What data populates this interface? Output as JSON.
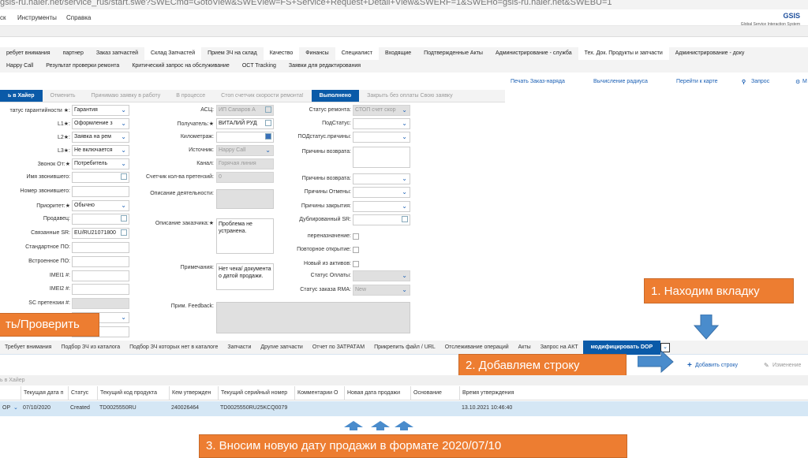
{
  "browser": {
    "url": "gsis-ru.haier.net/service_rus/start.swe?SWECmd=GotoView&SWEView=FS+Service+Request+Detail+View&SWERF=1&SWEHo=gsis-ru.haier.net&SWEBU=1"
  },
  "menu": {
    "items": [
      "ск",
      "Инструменты",
      "Справка"
    ],
    "logo": "GSIS",
    "logo_sub": "Global Service Interaction System"
  },
  "tabs_row1": [
    "ребует внимания",
    "партнер",
    "Заказ запчастей",
    "Склад Запчастей",
    "Прием ЗЧ на склад",
    "Качество",
    "Финансы",
    "Специалист",
    "Входящие",
    "Подтвержденные Акты",
    "Администрирование - служба",
    "Тех. Док. Продукты и запчасти",
    "Администрирование - доку"
  ],
  "tabs_row2": [
    "Happy Call",
    "Результат проверки ремонта",
    "Критический запрос на обслуживание",
    "OCT Tracking",
    "Заявки для редактирования"
  ],
  "actions": [
    "Печать Заказ-наряда",
    "Вычисление радиуса",
    "Перейти к карте",
    "Запрос",
    "М"
  ],
  "status_buttons": [
    "ь в Хайер",
    "Отменить",
    "Принимаю заявку в работу",
    "В процессе",
    "Стоп счетчик скорости ремонта!",
    "Выполнено",
    "Закрыть без оплаты Свою заявку"
  ],
  "form": {
    "left": [
      {
        "label": "татус гарантийности ★:",
        "value": "Гарантия",
        "type": "select"
      },
      {
        "label": "L1★:",
        "value": "Оформление з",
        "type": "select"
      },
      {
        "label": "L2★:",
        "value": "Заявка на рем",
        "type": "select"
      },
      {
        "label": "L3★:",
        "value": "Не включается",
        "type": "select"
      },
      {
        "label": "Звонок От:★",
        "value": "Потребитель",
        "type": "select"
      },
      {
        "label": "Имя звонившего:",
        "value": "",
        "type": "pick"
      },
      {
        "label": "Номер звонившего:",
        "value": "",
        "type": "text"
      },
      {
        "label": "Приоритет:★",
        "value": "Обычно",
        "type": "select"
      },
      {
        "label": "Продавец:",
        "value": "",
        "type": "pick"
      },
      {
        "label": "Связанные SR:",
        "value": "EU/RU21071800",
        "type": "pick"
      },
      {
        "label": "Стандартное ПО:",
        "value": "",
        "type": "text"
      },
      {
        "label": "Встроенное ПО:",
        "value": "",
        "type": "text"
      },
      {
        "label": "IMEI1 #:",
        "value": "",
        "type": "text"
      },
      {
        "label": "IMEI2 #:",
        "value": "",
        "type": "text"
      },
      {
        "label": "SC претензии #:",
        "value": "",
        "type": "ro"
      },
      {
        "label": "",
        "value": "",
        "type": "select"
      },
      {
        "label": "",
        "value": "",
        "type": "text"
      }
    ],
    "middle": [
      {
        "label": "АСЦ:",
        "value": "ИП Сапаров А",
        "type": "ropick"
      },
      {
        "label": "Получатель:★",
        "value": "ВИТАЛИЙ РУД",
        "type": "pick"
      },
      {
        "label": "Километраж:",
        "value": "",
        "type": "calc"
      },
      {
        "label": "Источник:",
        "value": "Happy Call",
        "type": "roselect"
      },
      {
        "label": "Канал:",
        "value": "Горячая линия",
        "type": "ro"
      },
      {
        "label": "Счетчик кол-ва претензий:",
        "value": "0",
        "type": "ro"
      }
    ],
    "middle_areas": [
      {
        "label": "Описание деятельности:",
        "value": "",
        "ro": true
      },
      {
        "label": "Описание заказчика:★",
        "value": "Проблема не устранена.",
        "ro": false
      },
      {
        "label": "Примечания:",
        "value": "Нет чека/ документа о датой продажи.",
        "ro": false
      },
      {
        "label": "Прим. Feedback:",
        "value": "",
        "ro": true
      }
    ],
    "right": [
      {
        "label": "Статус ремонта:",
        "value": "СТОП счет скор",
        "type": "roselect"
      },
      {
        "label": "ПодСтатус:",
        "value": "",
        "type": "select"
      },
      {
        "label": "ПОДстатус.причины:",
        "value": "",
        "type": "select"
      },
      {
        "label": "Причины возврата:",
        "value": "",
        "type": "area"
      },
      {
        "label": "Причины возврата:",
        "value": "",
        "type": "select"
      },
      {
        "label": "Причины Отмены:",
        "value": "",
        "type": "select"
      },
      {
        "label": "Причины закрытия:",
        "value": "",
        "type": "select"
      },
      {
        "label": "Дублированный SR:",
        "value": "",
        "type": "pick"
      },
      {
        "label": "переназначение:",
        "value": "",
        "type": "check"
      },
      {
        "label": "Повторное открытие:",
        "value": "",
        "type": "check"
      },
      {
        "label": "Новый из активов:",
        "value": "",
        "type": "check"
      },
      {
        "label": "Статус Оплаты:",
        "value": "",
        "type": "roselect"
      },
      {
        "label": "Статус заказа RMA:",
        "value": "New",
        "type": "roselect"
      }
    ]
  },
  "lower_tabs": [
    "Требует внимания",
    "Подбор ЗЧ из каталога",
    "Подбор ЗЧ которых нет в каталоге",
    "Запчасти",
    "Другие запчасти",
    "Отчет по ЗАТРАТАМ",
    "Прикрепить файл / URL",
    "Отслеживание операций",
    "Акты",
    "Запрос на АКТ",
    "модифицировать DOP"
  ],
  "toolbar": {
    "add_row": "Добавить строку",
    "edit": "Изменение"
  },
  "list": {
    "title": "ь в Хайер",
    "columns": [
      "",
      "Текущая дата п",
      "Статус",
      "Текущий код продукта",
      "Кем утвержден",
      "Текущий серийный номер",
      "Комментарии О",
      "Новая дата продажи",
      "Основание",
      "Время утверждения"
    ],
    "rows": [
      [
        "OP",
        "07/10/2020",
        "Created",
        "TD0025550RU",
        "240026464",
        "TD0025550RU25KCQ0079",
        "",
        "",
        "",
        "13.10.2021 10:46:40"
      ]
    ]
  },
  "callouts": {
    "check": "ть/Проверить",
    "step1": "1. Находим вкладку",
    "step2": "2. Добавляем строку",
    "step3": "3. Вносим новую дату продажи в формате 2020/07/10"
  },
  "colors": {
    "accent": "#0a5aa8",
    "callout": "#ed7d31",
    "arrow": "#4a8ccc",
    "row_selected": "#d5e7f5"
  }
}
